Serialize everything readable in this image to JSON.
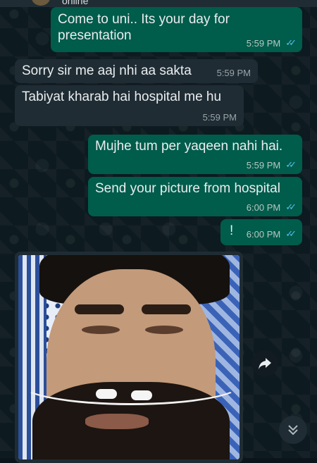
{
  "header": {
    "status": "online"
  },
  "messages": [
    {
      "id": 1,
      "dir": "out",
      "text": "Come to uni.. Its your day for presentation",
      "time": "5:59 PM"
    },
    {
      "id": 2,
      "dir": "in",
      "text": "Sorry sir me aaj nhi aa sakta",
      "time": "5:59 PM"
    },
    {
      "id": 3,
      "dir": "in",
      "text": "Tabiyat kharab hai hospital me hu",
      "time": "5:59 PM"
    },
    {
      "id": 4,
      "dir": "out",
      "text": "Mujhe tum per yaqeen nahi hai.",
      "time": "5:59 PM"
    },
    {
      "id": 5,
      "dir": "out",
      "text": "Send your picture from hospital",
      "time": "6:00 PM"
    },
    {
      "id": 6,
      "dir": "out",
      "text": "!",
      "time": "6:00 PM"
    }
  ],
  "image_message": {
    "icon": "photo-of-man-in-hospital-bed"
  },
  "icons": {
    "forward": "forward-icon",
    "scroll_down": "chevron-double-down-icon",
    "read_receipt": "double-check-icon"
  },
  "colors": {
    "outgoing_bubble": "#005c4b",
    "incoming_bubble": "#1f2c34",
    "tick_blue": "#53bdeb",
    "background": "#0b141a"
  }
}
